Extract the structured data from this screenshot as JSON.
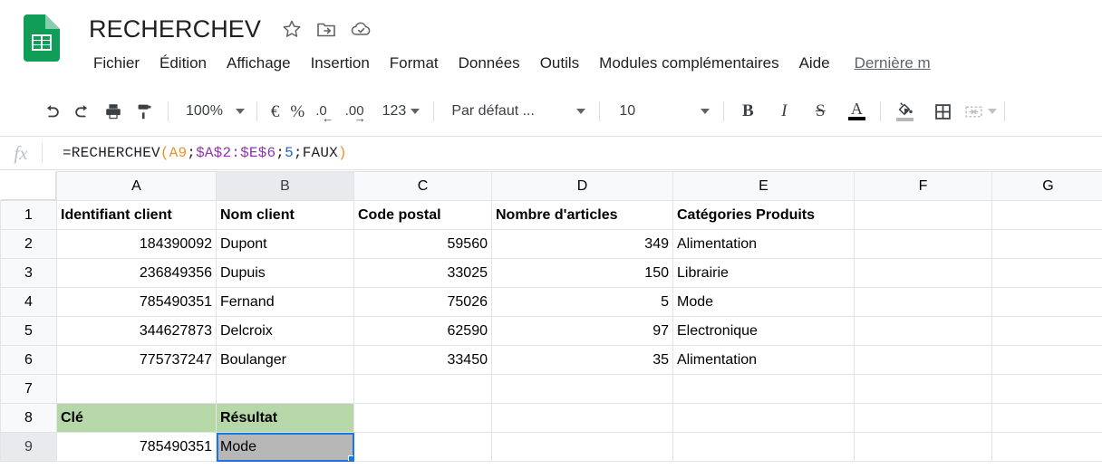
{
  "app": {
    "doc_title": "RECHERCHEV",
    "title_icons": [
      "star-icon",
      "move-to-folder-icon",
      "cloud-saved-icon"
    ],
    "menus": [
      "Fichier",
      "Édition",
      "Affichage",
      "Insertion",
      "Format",
      "Données",
      "Outils",
      "Modules complémentaires",
      "Aide"
    ],
    "last_modified": "Dernière m",
    "accent_blue": "#1a73e8",
    "sheets_green": "#0f9d58"
  },
  "toolbar": {
    "undo": "undo-icon",
    "redo": "redo-icon",
    "print": "print-icon",
    "paint_format": "paint-format-icon",
    "zoom_value": "100%",
    "currency": "€",
    "percent": "%",
    "decrease_decimal": ".0",
    "increase_decimal": ".00",
    "more_formats": "123",
    "font_family": "Par défaut ...",
    "font_size": "10",
    "bold": "B",
    "italic": "I",
    "strikethrough": "S",
    "text_color": "A",
    "text_color_swatch": "#000000",
    "fill_color": "fill-color-icon",
    "fill_color_swatch": "#b7b7b7",
    "borders": "borders-icon",
    "merge_cells": "merge-cells-icon"
  },
  "formula_bar": {
    "fx_label": "fx",
    "formula_prefix": "=RECHERCHEV",
    "open_paren": "(",
    "arg_lookup": "A9",
    "sep1": ";",
    "arg_range": "$A$2:$E$6",
    "sep2": ";",
    "arg_index": "5",
    "sep3": ";",
    "arg_exact": "FAUX",
    "close_paren": ")",
    "full_formula": "=RECHERCHEV(A9;$A$2:$E$6;5;FAUX)"
  },
  "sheet": {
    "columns": [
      "A",
      "B",
      "C",
      "D",
      "E",
      "F",
      "G"
    ],
    "selected_column": "B",
    "selected_row": "9",
    "selected_cell": "B9",
    "rows": [
      {
        "num": "1",
        "cells": [
          {
            "v": "Identifiant client",
            "align": "txt",
            "bold": true
          },
          {
            "v": "Nom client",
            "align": "txt",
            "bold": true
          },
          {
            "v": "Code postal",
            "align": "txt",
            "bold": true
          },
          {
            "v": "Nombre d'articles",
            "align": "txt",
            "bold": true
          },
          {
            "v": "Catégories Produits",
            "align": "txt",
            "bold": true
          },
          {
            "v": "",
            "align": "txt"
          },
          {
            "v": "",
            "align": "txt"
          }
        ]
      },
      {
        "num": "2",
        "cells": [
          {
            "v": "184390092",
            "align": "num"
          },
          {
            "v": "Dupont",
            "align": "txt"
          },
          {
            "v": "59560",
            "align": "num"
          },
          {
            "v": "349",
            "align": "num"
          },
          {
            "v": "Alimentation",
            "align": "txt"
          },
          {
            "v": "",
            "align": "txt"
          },
          {
            "v": "",
            "align": "txt"
          }
        ]
      },
      {
        "num": "3",
        "cells": [
          {
            "v": "236849356",
            "align": "num"
          },
          {
            "v": "Dupuis",
            "align": "txt"
          },
          {
            "v": "33025",
            "align": "num"
          },
          {
            "v": "150",
            "align": "num"
          },
          {
            "v": "Librairie",
            "align": "txt"
          },
          {
            "v": "",
            "align": "txt"
          },
          {
            "v": "",
            "align": "txt"
          }
        ]
      },
      {
        "num": "4",
        "cells": [
          {
            "v": "785490351",
            "align": "num"
          },
          {
            "v": "Fernand",
            "align": "txt"
          },
          {
            "v": "75026",
            "align": "num"
          },
          {
            "v": "5",
            "align": "num"
          },
          {
            "v": "Mode",
            "align": "txt"
          },
          {
            "v": "",
            "align": "txt"
          },
          {
            "v": "",
            "align": "txt"
          }
        ]
      },
      {
        "num": "5",
        "cells": [
          {
            "v": "344627873",
            "align": "num"
          },
          {
            "v": "Delcroix",
            "align": "txt"
          },
          {
            "v": "62590",
            "align": "num"
          },
          {
            "v": "97",
            "align": "num"
          },
          {
            "v": "Electronique",
            "align": "txt"
          },
          {
            "v": "",
            "align": "txt"
          },
          {
            "v": "",
            "align": "txt"
          }
        ]
      },
      {
        "num": "6",
        "cells": [
          {
            "v": "775737247",
            "align": "num"
          },
          {
            "v": "Boulanger",
            "align": "txt"
          },
          {
            "v": "33450",
            "align": "num"
          },
          {
            "v": "35",
            "align": "num"
          },
          {
            "v": "Alimentation",
            "align": "txt"
          },
          {
            "v": "",
            "align": "txt"
          },
          {
            "v": "",
            "align": "txt"
          }
        ]
      },
      {
        "num": "7",
        "cells": [
          {
            "v": "",
            "align": "txt"
          },
          {
            "v": "",
            "align": "txt"
          },
          {
            "v": "",
            "align": "txt"
          },
          {
            "v": "",
            "align": "txt"
          },
          {
            "v": "",
            "align": "txt"
          },
          {
            "v": "",
            "align": "txt"
          },
          {
            "v": "",
            "align": "txt"
          }
        ]
      },
      {
        "num": "8",
        "cells": [
          {
            "v": "Clé",
            "align": "txt",
            "bold": true,
            "fill": "green"
          },
          {
            "v": "Résultat",
            "align": "txt",
            "bold": true,
            "fill": "green"
          },
          {
            "v": "",
            "align": "txt"
          },
          {
            "v": "",
            "align": "txt"
          },
          {
            "v": "",
            "align": "txt"
          },
          {
            "v": "",
            "align": "txt"
          },
          {
            "v": "",
            "align": "txt"
          }
        ]
      },
      {
        "num": "9",
        "cells": [
          {
            "v": "785490351",
            "align": "num"
          },
          {
            "v": "Mode",
            "align": "txt",
            "selected": true
          },
          {
            "v": "",
            "align": "txt"
          },
          {
            "v": "",
            "align": "txt"
          },
          {
            "v": "",
            "align": "txt"
          },
          {
            "v": "",
            "align": "txt"
          },
          {
            "v": "",
            "align": "txt"
          }
        ]
      }
    ]
  }
}
